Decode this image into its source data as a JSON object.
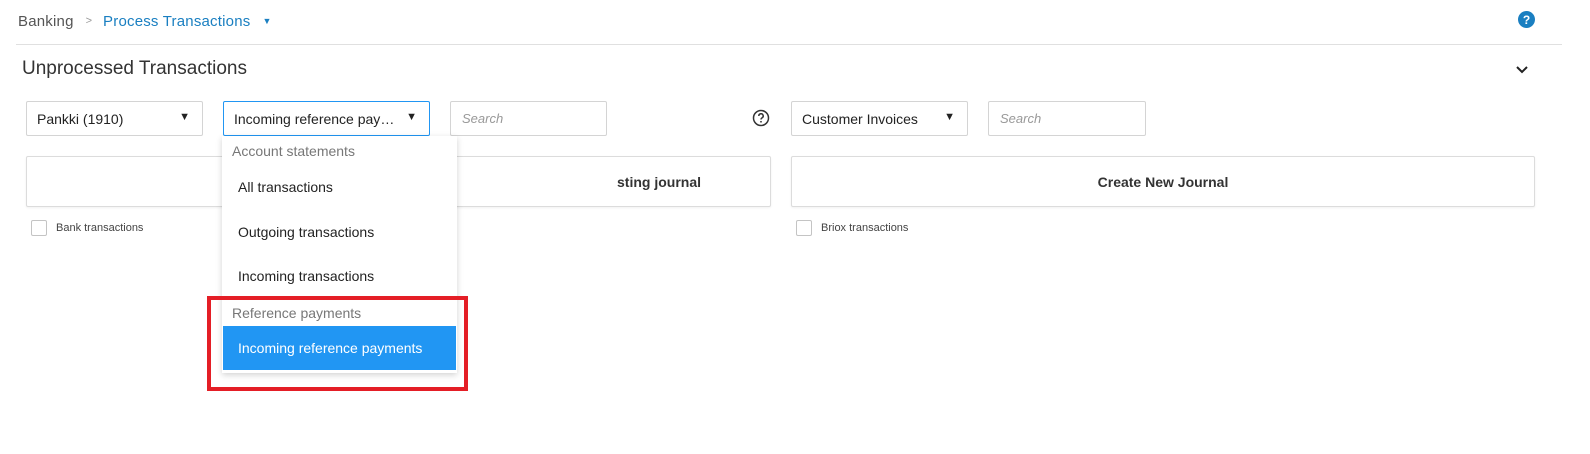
{
  "breadcrumb": {
    "root": "Banking",
    "separator": ">",
    "current": "Process Transactions"
  },
  "header": {
    "help_icon": "help-circle-icon",
    "help_glyph": "?"
  },
  "section": {
    "title": "Unprocessed Transactions",
    "collapse_icon": "chevron-down-icon"
  },
  "filters": {
    "account_select": "Pankki (1910)",
    "type_select": "Incoming reference payments",
    "search_left_placeholder": "Search",
    "help_icon": "question-circle-icon",
    "document_select": "Customer Invoices",
    "search_right_placeholder": "Search"
  },
  "buttons": {
    "existing_journal_partial": "sting journal",
    "create_new_journal": "Create New Journal"
  },
  "checkboxes": {
    "bank_transactions": "Bank transactions",
    "briox_transactions": "Briox transactions"
  },
  "dropdown": {
    "groups": [
      {
        "label": "Account statements",
        "items": [
          "All transactions",
          "Outgoing transactions",
          "Incoming transactions"
        ]
      },
      {
        "label": "Reference payments",
        "items": [
          "Incoming reference payments"
        ]
      }
    ],
    "selected": "Incoming reference payments"
  },
  "colors": {
    "accent": "#1a7fc1",
    "selected": "#2196f3",
    "highlight": "#e41e26"
  }
}
